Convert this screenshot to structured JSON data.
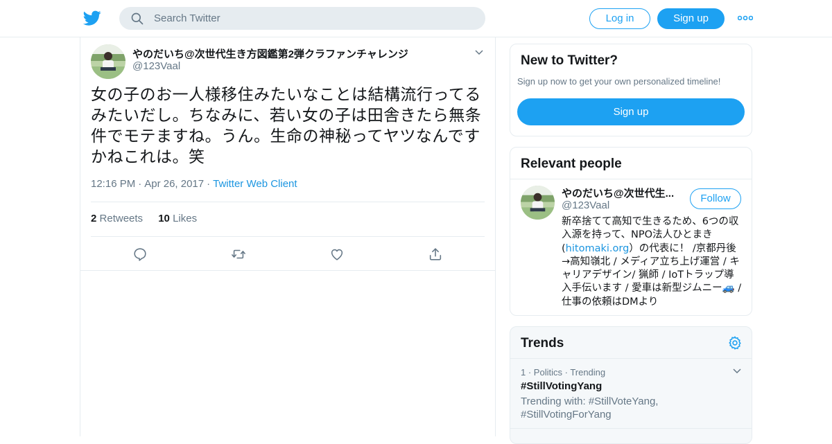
{
  "nav": {
    "search_placeholder": "Search Twitter",
    "login_label": "Log in",
    "signup_label": "Sign up"
  },
  "tweet": {
    "author_name": "やのだいち@次世代生き方図鑑第2弾クラファンチャレンジ",
    "author_handle": "@123Vaal",
    "text": "女の子のお一人様移住みたいなことは結構流行ってるみたいだし。ちなみに、若い女の子は田舎きたら無条件でモテますね。うん。生命の神秘ってヤツなんですかねこれは。笑",
    "time": "12:16 PM",
    "date": "Apr 26, 2017",
    "client": "Twitter Web Client",
    "retweets_count": "2",
    "retweets_label": "Retweets",
    "likes_count": "10",
    "likes_label": "Likes"
  },
  "new_to_twitter": {
    "heading": "New to Twitter?",
    "subtext": "Sign up now to get your own personalized timeline!",
    "signup_label": "Sign up"
  },
  "relevant_people": {
    "heading": "Relevant people",
    "person": {
      "name": "やのだいち@次世代生...",
      "handle": "@123Vaal",
      "follow_label": "Follow",
      "bio_part1": "新卒捨てて高知で生きるため、6つの収入源を持って、NPO法人ひとまき(",
      "bio_link": "hitomaki.org",
      "bio_part2": "）の代表に！ /京都丹後→高知嶺北 / メディア立ち上げ運営 / キャリアデザイン/ 猟師 / IoTトラップ導入手伝います / 愛車は新型ジムニー🚙 / 仕事の依頼はDMより"
    }
  },
  "trends": {
    "heading": "Trends",
    "items": [
      {
        "rank": "1",
        "category": "Politics",
        "status": "Trending",
        "hashtag": "#StillVotingYang",
        "trending_with": "Trending with: #StillVoteYang, #StillVotingForYang"
      }
    ]
  },
  "colors": {
    "brand_blue": "#1da1f2",
    "link_blue": "#1b95e0",
    "secondary_text": "#657786",
    "border": "#e6ecf0"
  },
  "icons": [
    "twitter-bird-icon",
    "search-icon",
    "more-icon",
    "chevron-down-icon",
    "reply-icon",
    "retweet-icon",
    "like-icon",
    "share-icon",
    "gear-icon"
  ]
}
